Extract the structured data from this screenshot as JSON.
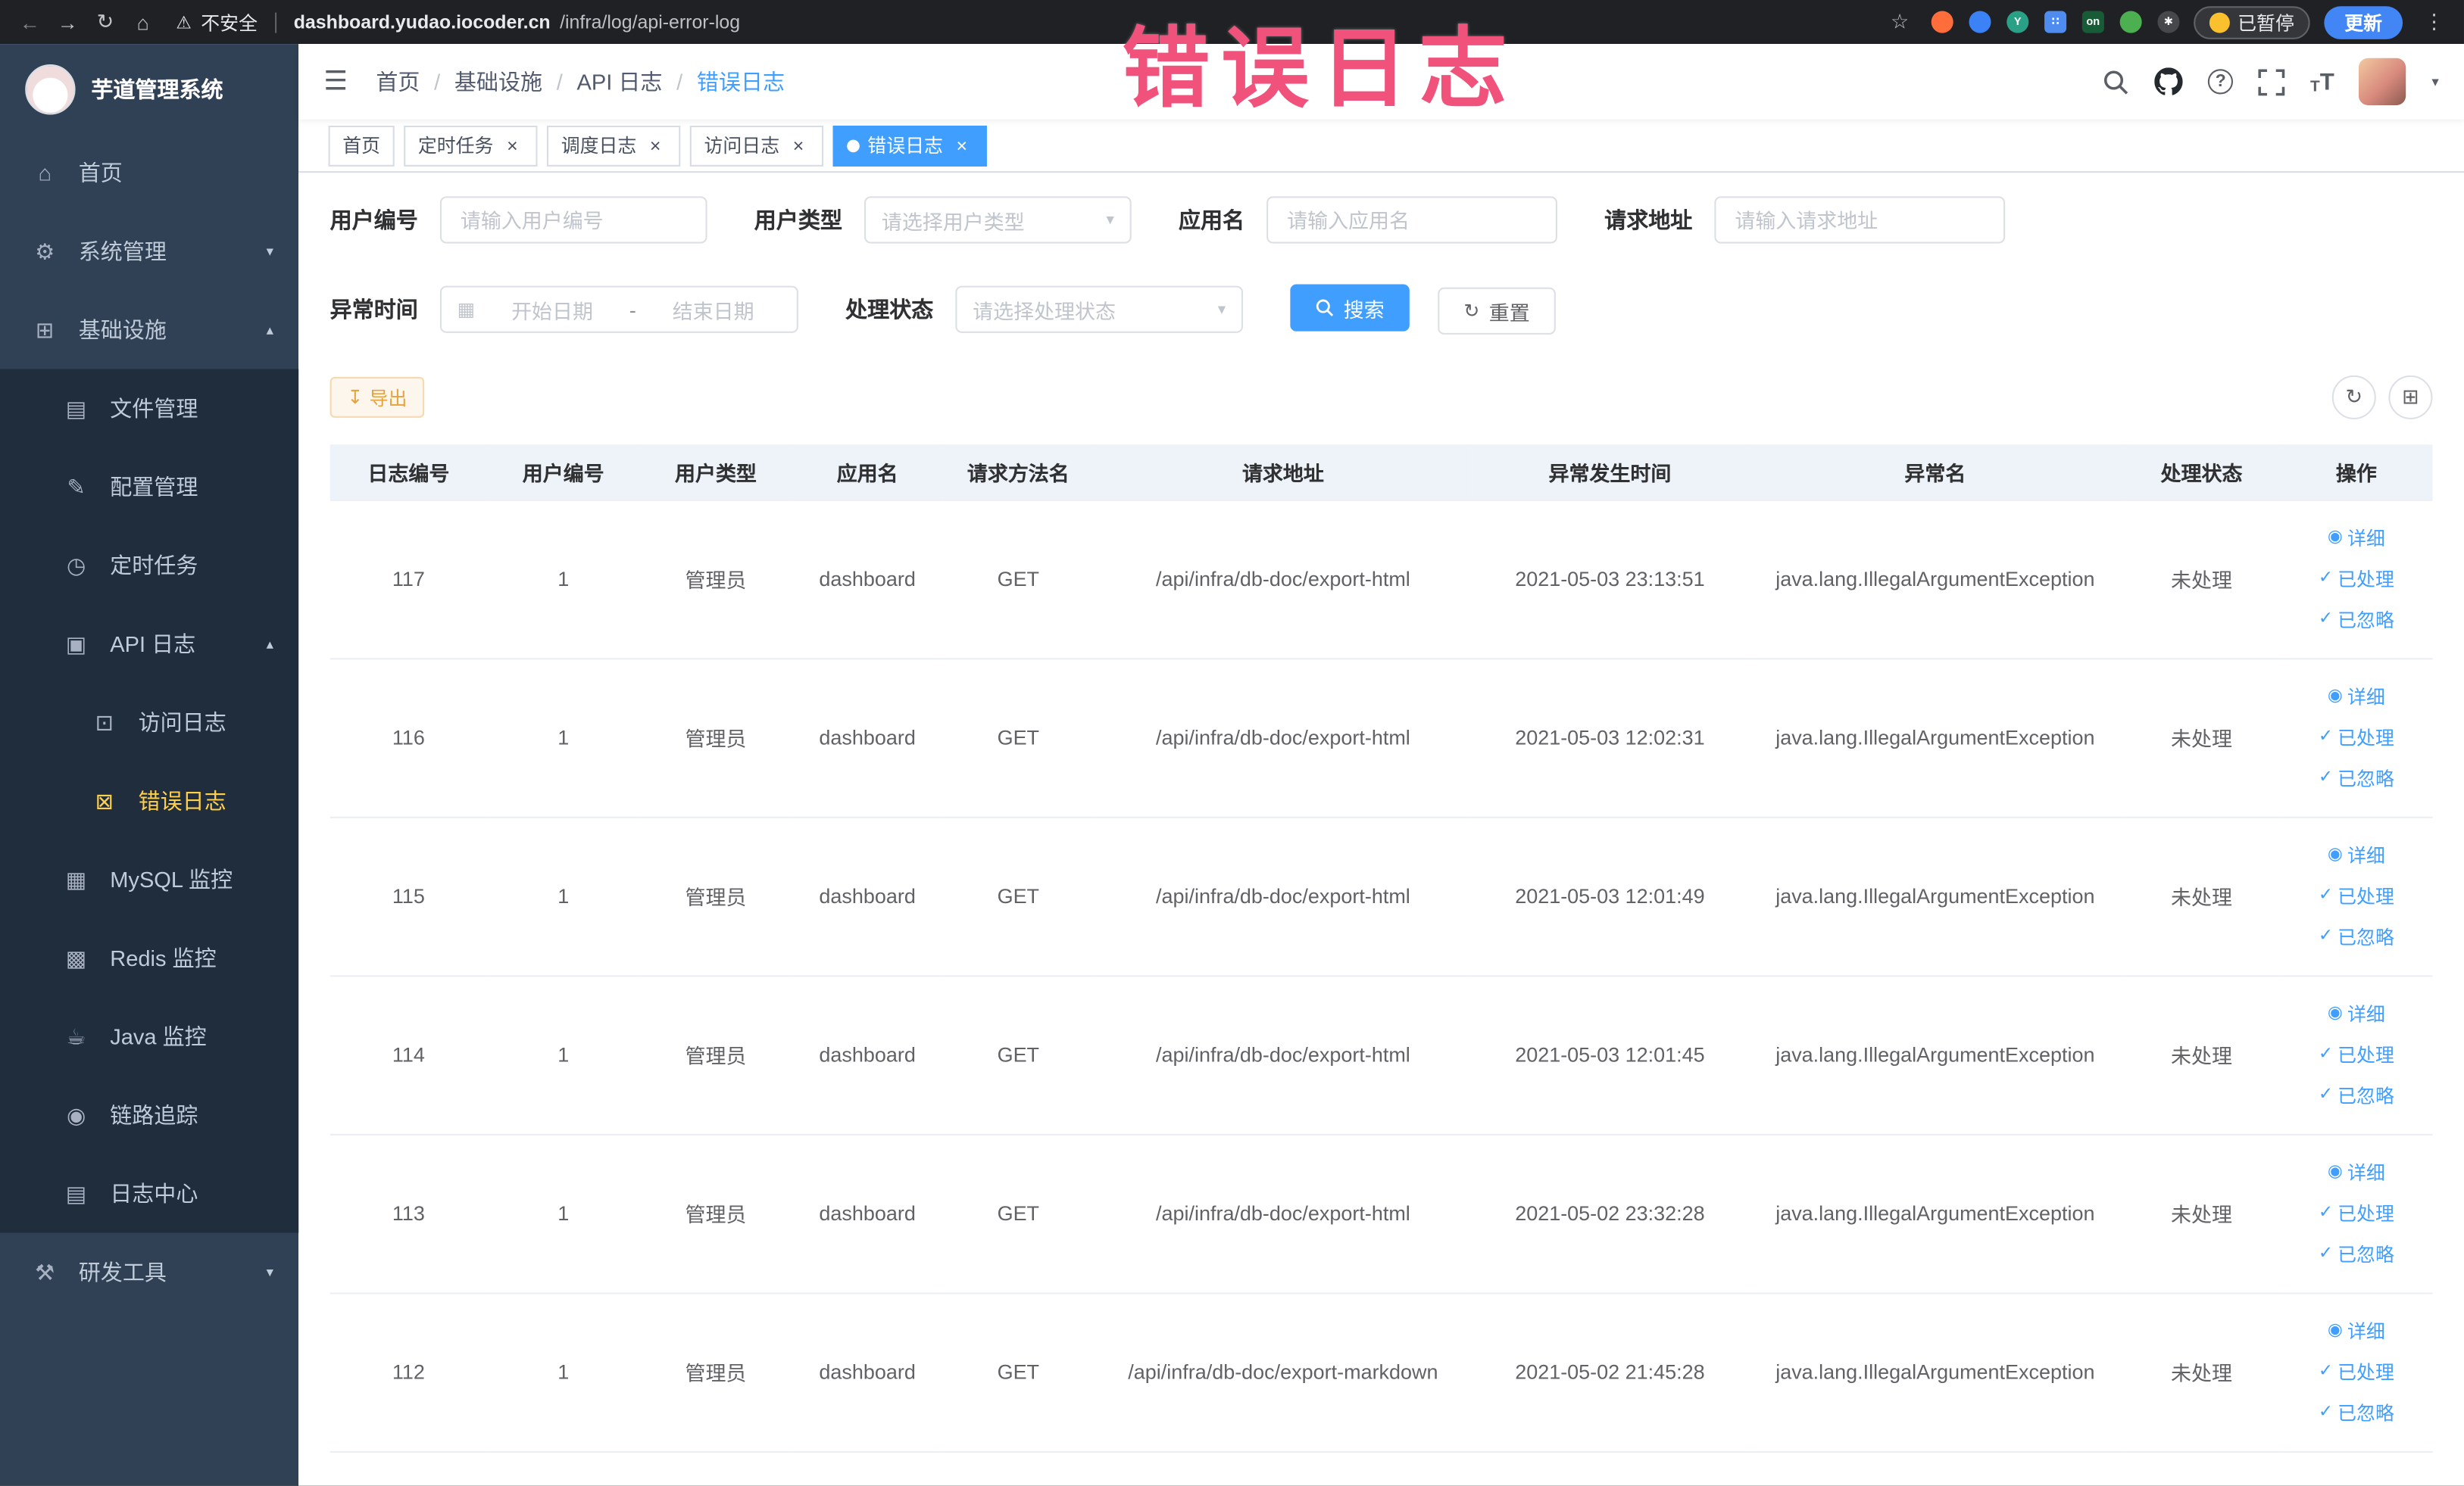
{
  "colors": {
    "primary": "#409eff",
    "sidebar_bg": "#304156",
    "submenu_bg": "#1f2d3d",
    "active_menu_text": "#ffd04b",
    "warning": "#e6a23c",
    "annotation": "#f1527c"
  },
  "icons": {
    "back": "←",
    "forward": "→",
    "reload": "↻",
    "home": "⌂",
    "warning": "⚠",
    "star": "☆",
    "dots": "⋮",
    "hamburger": "☰",
    "question": "?",
    "chevron_down": "▾",
    "chevron_up": "▴",
    "caret_down": "▾",
    "refresh": "↻",
    "download": "↧",
    "grid": "⊞",
    "calendar": "▦",
    "eye": "◉",
    "check": "✓",
    "font_size": "T"
  },
  "browser": {
    "security_label": "不安全",
    "url_host": "dashboard.yudao.iocoder.cn",
    "url_path": "/infra/log/api-error-log",
    "paused_button": "已暂停",
    "update_button": "更新",
    "extensions": [
      {
        "name": "record-extension-icon",
        "shape": "circle",
        "color": "#ff6d3b"
      },
      {
        "name": "water-drop-extension-icon",
        "shape": "circle",
        "color": "#3b82f6"
      },
      {
        "name": "y-extension-icon",
        "shape": "circle",
        "color": "#2aa187",
        "text": "Y"
      },
      {
        "name": "grid-extension-icon",
        "shape": "square",
        "color": "#4e8cf0",
        "text": "∷"
      },
      {
        "name": "on-badge-extension-icon",
        "shape": "square",
        "color": "#185c37",
        "text": "on"
      },
      {
        "name": "leaf-extension-icon",
        "shape": "circle",
        "color": "#4caf50"
      },
      {
        "name": "pin-extension-icon",
        "shape": "circle",
        "color": "#46484b",
        "text": "✱"
      }
    ]
  },
  "annotation": {
    "text": "错误日志"
  },
  "sidebar": {
    "logo_title": "芋道管理系统",
    "items": [
      {
        "key": "home",
        "label": "首页",
        "icon": "⌂",
        "icon_name": "home-icon",
        "level": 1
      },
      {
        "key": "system-management",
        "label": "系统管理",
        "icon": "⚙",
        "icon_name": "gear-icon",
        "level": 1,
        "chevron": "down"
      },
      {
        "key": "infrastructure",
        "label": "基础设施",
        "icon": "⊞",
        "icon_name": "infrastructure-icon",
        "level": 1,
        "chevron": "up"
      },
      {
        "key": "file-management",
        "label": "文件管理",
        "icon": "▤",
        "icon_name": "file-icon",
        "level": 2
      },
      {
        "key": "config-management",
        "label": "配置管理",
        "icon": "✎",
        "icon_name": "edit-icon",
        "level": 2
      },
      {
        "key": "scheduled-tasks",
        "label": "定时任务",
        "icon": "◷",
        "icon_name": "timer-icon",
        "level": 2
      },
      {
        "key": "api-log",
        "label": "API 日志",
        "icon": "▣",
        "icon_name": "log-icon",
        "level": 2,
        "chevron": "up"
      },
      {
        "key": "access-log",
        "label": "访问日志",
        "icon": "⊡",
        "icon_name": "access-log-icon",
        "level": 3
      },
      {
        "key": "error-log",
        "label": "错误日志",
        "icon": "⊠",
        "icon_name": "error-log-icon",
        "level": 3,
        "active": true
      },
      {
        "key": "mysql-monitor",
        "label": "MySQL 监控",
        "icon": "▦",
        "icon_name": "database-icon",
        "level": 2
      },
      {
        "key": "redis-monitor",
        "label": "Redis 监控",
        "icon": "▩",
        "icon_name": "redis-icon",
        "level": 2
      },
      {
        "key": "java-monitor",
        "label": "Java 监控",
        "icon": "☕",
        "icon_name": "coffee-icon",
        "level": 2
      },
      {
        "key": "link-tracing",
        "label": "链路追踪",
        "icon": "◉",
        "icon_name": "eye-icon",
        "level": 2
      },
      {
        "key": "log-center",
        "label": "日志中心",
        "icon": "▤",
        "icon_name": "log-center-icon",
        "level": 2
      },
      {
        "key": "dev-tools",
        "label": "研发工具",
        "icon": "⚒",
        "icon_name": "tools-icon",
        "level": 1,
        "chevron": "down"
      }
    ]
  },
  "header": {
    "breadcrumb": [
      "首页",
      "基础设施",
      "API 日志",
      "错误日志"
    ]
  },
  "tabs": [
    {
      "key": "home",
      "label": "首页",
      "closable": false,
      "active": false
    },
    {
      "key": "scheduled-tasks",
      "label": "定时任务",
      "closable": true,
      "active": false
    },
    {
      "key": "schedule-log",
      "label": "调度日志",
      "closable": true,
      "active": false
    },
    {
      "key": "access-log",
      "label": "访问日志",
      "closable": true,
      "active": false
    },
    {
      "key": "error-log",
      "label": "错误日志",
      "closable": true,
      "active": true
    }
  ],
  "filters": {
    "user_id_label": "用户编号",
    "user_id_placeholder": "请输入用户编号",
    "user_type_label": "用户类型",
    "user_type_placeholder": "请选择用户类型",
    "app_name_label": "应用名",
    "app_name_placeholder": "请输入应用名",
    "request_url_label": "请求地址",
    "request_url_placeholder": "请输入请求地址",
    "exception_time_label": "异常时间",
    "start_date_placeholder": "开始日期",
    "date_separator": "-",
    "end_date_placeholder": "结束日期",
    "process_status_label": "处理状态",
    "process_status_placeholder": "请选择处理状态",
    "search_button": "搜索",
    "reset_button": "重置"
  },
  "toolbar": {
    "export_button": "导出"
  },
  "table": {
    "columns": [
      "日志编号",
      "用户编号",
      "用户类型",
      "应用名",
      "请求方法名",
      "请求地址",
      "异常发生时间",
      "异常名",
      "处理状态",
      "操作"
    ],
    "actions": [
      {
        "key": "detail",
        "label": "详细",
        "icon": "◉",
        "icon_name": "eye-icon"
      },
      {
        "key": "processed",
        "label": "已处理",
        "icon": "✓",
        "icon_name": "check-icon"
      },
      {
        "key": "ignored",
        "label": "已忽略",
        "icon": "✓",
        "icon_name": "check-icon"
      }
    ],
    "rows": [
      {
        "id": "117",
        "user_id": "1",
        "user_type": "管理员",
        "app": "dashboard",
        "method": "GET",
        "url": "/api/infra/db-doc/export-html",
        "time": "2021-05-03 23:13:51",
        "exception": "java.lang.IllegalArgumentException",
        "status": "未处理"
      },
      {
        "id": "116",
        "user_id": "1",
        "user_type": "管理员",
        "app": "dashboard",
        "method": "GET",
        "url": "/api/infra/db-doc/export-html",
        "time": "2021-05-03 12:02:31",
        "exception": "java.lang.IllegalArgumentException",
        "status": "未处理"
      },
      {
        "id": "115",
        "user_id": "1",
        "user_type": "管理员",
        "app": "dashboard",
        "method": "GET",
        "url": "/api/infra/db-doc/export-html",
        "time": "2021-05-03 12:01:49",
        "exception": "java.lang.IllegalArgumentException",
        "status": "未处理"
      },
      {
        "id": "114",
        "user_id": "1",
        "user_type": "管理员",
        "app": "dashboard",
        "method": "GET",
        "url": "/api/infra/db-doc/export-html",
        "time": "2021-05-03 12:01:45",
        "exception": "java.lang.IllegalArgumentException",
        "status": "未处理"
      },
      {
        "id": "113",
        "user_id": "1",
        "user_type": "管理员",
        "app": "dashboard",
        "method": "GET",
        "url": "/api/infra/db-doc/export-html",
        "time": "2021-05-02 23:32:28",
        "exception": "java.lang.IllegalArgumentException",
        "status": "未处理"
      },
      {
        "id": "112",
        "user_id": "1",
        "user_type": "管理员",
        "app": "dashboard",
        "method": "GET",
        "url": "/api/infra/db-doc/export-markdown",
        "time": "2021-05-02 21:45:28",
        "exception": "java.lang.IllegalArgumentException",
        "status": "未处理"
      }
    ]
  }
}
